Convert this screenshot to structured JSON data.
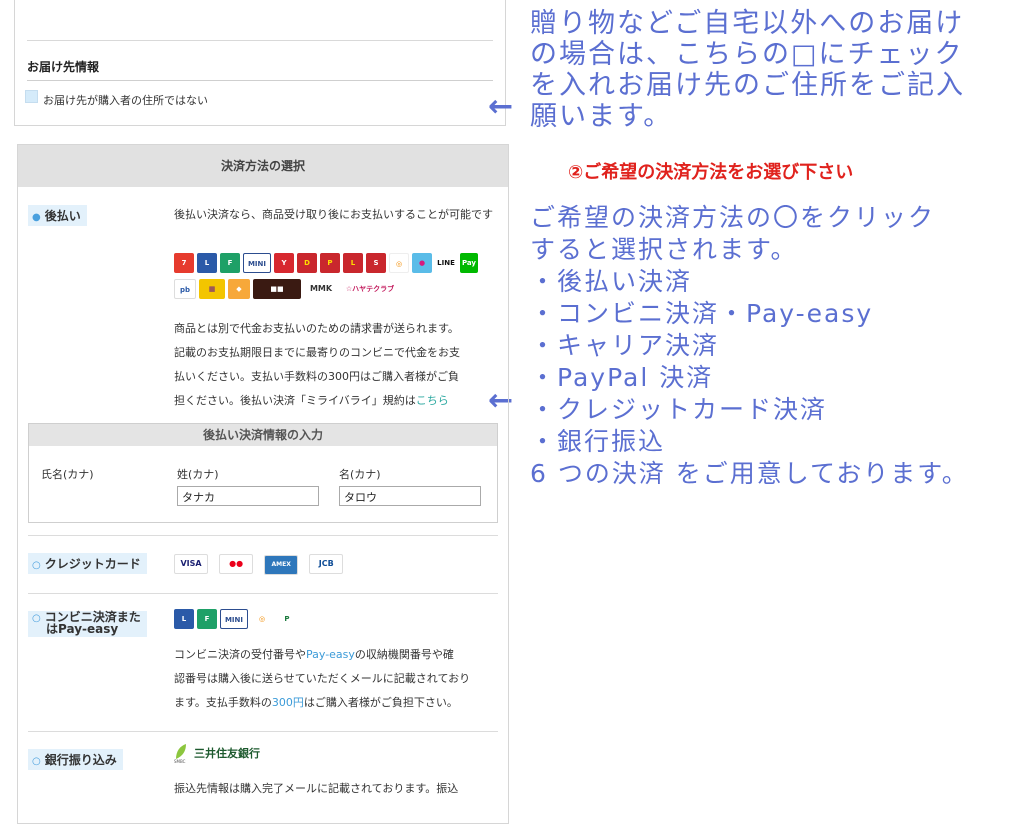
{
  "delivery": {
    "section_title": "お届け先情報",
    "checkbox_label": "お届け先が購入者の住所ではない"
  },
  "notes": {
    "note1_lines": [
      "贈り物などご自宅以外へのお届け",
      "の場合は、こちらの□にチェック",
      "を入れお届け先のご住所をご記入",
      "願います。"
    ],
    "note2": "②ご希望の決済方法をお選び下さい",
    "note3_lines": [
      "ご希望の決済方法の〇をクリック",
      "すると選択されます。",
      "・後払い決済",
      "・コンビニ決済・Pay-easy",
      "・キャリア決済",
      "・PayPal 決済",
      "・クレジットカード決済",
      "・銀行振込",
      "6 つの決済 をご用意しております。"
    ],
    "arrow": "←"
  },
  "payment": {
    "header": "決済方法の選択",
    "atobarai": {
      "label": "後払い",
      "desc1": "後払い決済なら、商品受け取り後にお支払いすることが可能です",
      "desc2_lines": [
        "商品とは別で代金お支払いのための請求書が送られます。",
        "記載のお支払期限日までに最寄りのコンビニで代金をお支",
        "払いください。支払い手数料の300円はご購入者様がご負"
      ],
      "desc2_last": "担ください。後払い決済「ミライバライ」規約は",
      "link": "こちら",
      "logos": {
        "line": "LINE",
        "pay": "Pay",
        "mmk": "MMK",
        "hayate": "☆ハヤテクラブ"
      },
      "form": {
        "title": "後払い決済情報の入力",
        "name_label": "氏名(カナ)",
        "sei_label": "姓(カナ)",
        "mei_label": "名(カナ)",
        "sei_value": "タナカ",
        "mei_value": "タロウ"
      }
    },
    "credit": {
      "label": "クレジットカード",
      "cards": [
        "VISA",
        "●●",
        "AMEX",
        "JCB"
      ]
    },
    "convenience": {
      "label_line1": "コンビニ決済また",
      "label_line2": "はPay-easy",
      "desc_lines_1": "コンビニ決済の受付番号や",
      "desc_hl": "Pay-easy",
      "desc_lines_1b": "の収納機関番号や確",
      "desc_line2": "認番号は購入後に送らせていただくメールに記載されており",
      "desc_line3a": "ます。支払手数料の",
      "desc_line3_hl": "300円",
      "desc_line3b": "はご購入者様がご負担下さい。"
    },
    "bank": {
      "label": "銀行振り込み",
      "bank_name": "三井住友銀行",
      "smbc": "SMBC",
      "desc": "振込先情報は購入完了メールに記載されております。振込"
    }
  },
  "colors": {
    "annotation_blue": "#5b6fd1",
    "annotation_red": "#e0221d",
    "link_teal": "#2ba8a0",
    "radio_bg": "#e3f1fb"
  }
}
